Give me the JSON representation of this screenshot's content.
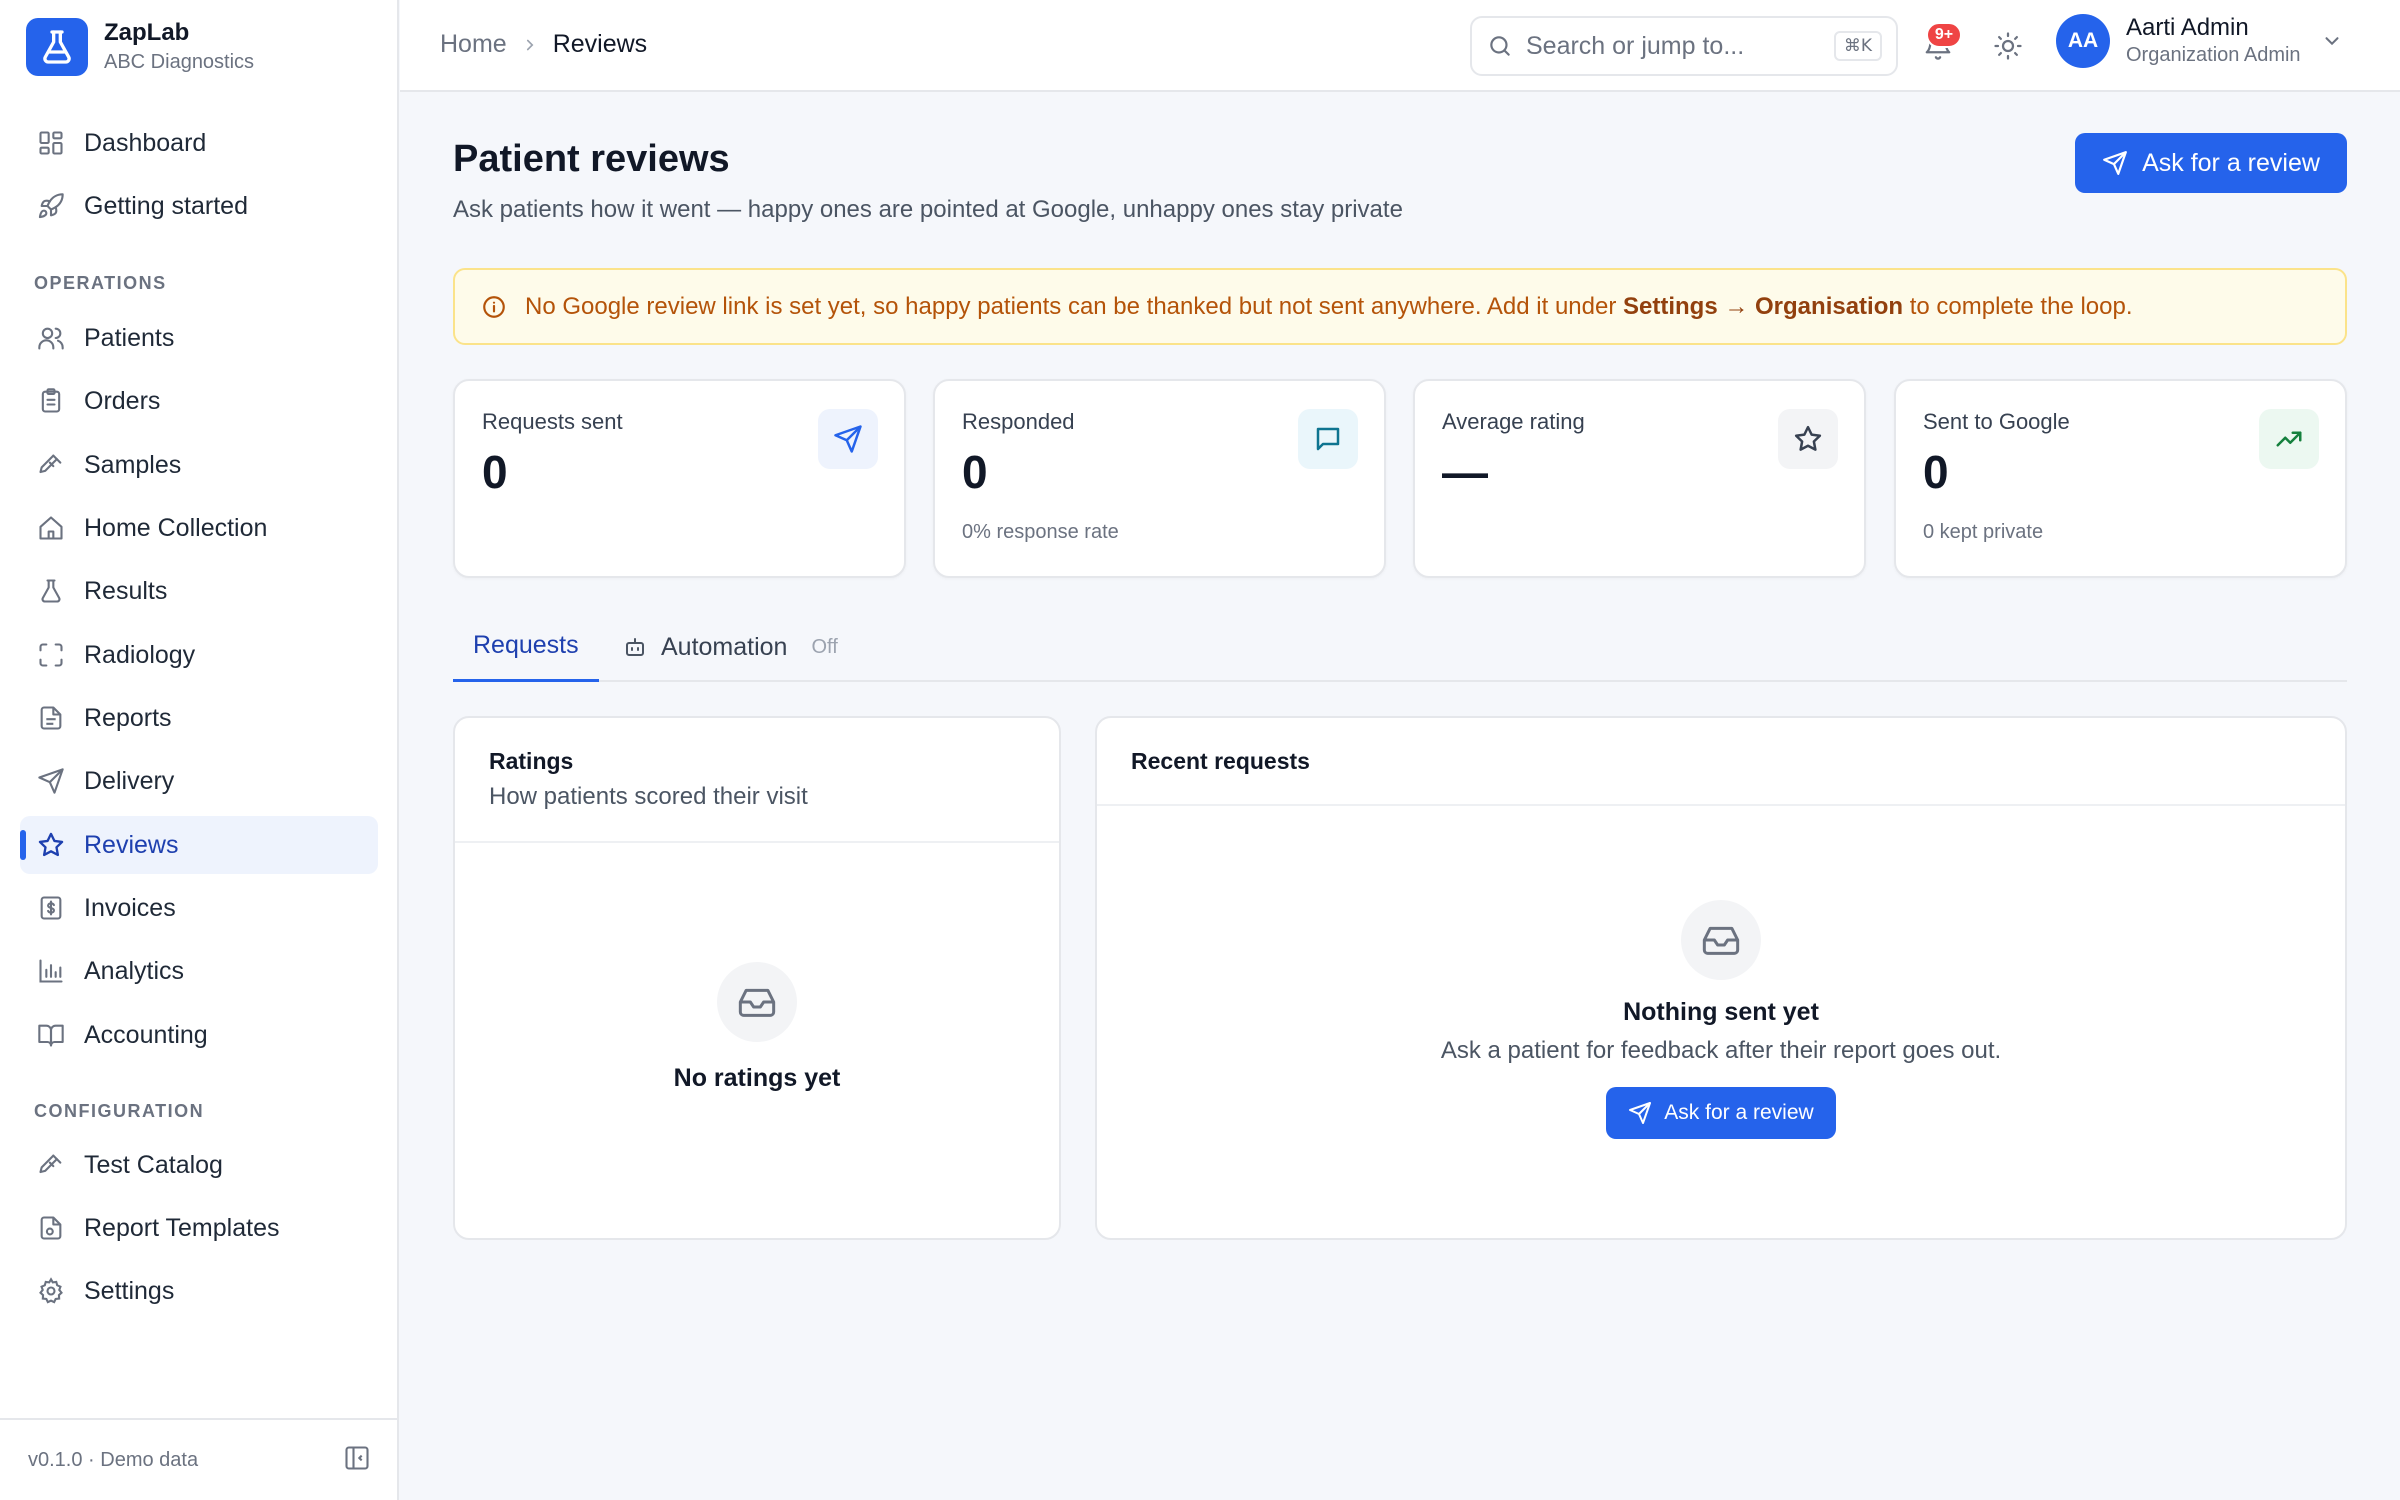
{
  "brand": {
    "name": "ZapLab",
    "org": "ABC Diagnostics",
    "logo_icon": "flask-icon"
  },
  "sidebar": {
    "items_top": [
      {
        "label": "Dashboard",
        "icon": "dashboard-icon"
      },
      {
        "label": "Getting started",
        "icon": "rocket-icon"
      }
    ],
    "sections": [
      {
        "label": "OPERATIONS"
      },
      {
        "label": "CONFIGURATION"
      }
    ],
    "operations": [
      {
        "label": "Patients"
      },
      {
        "label": "Orders"
      },
      {
        "label": "Samples"
      },
      {
        "label": "Home Collection"
      },
      {
        "label": "Results"
      },
      {
        "label": "Radiology"
      },
      {
        "label": "Reports"
      },
      {
        "label": "Delivery"
      },
      {
        "label": "Reviews"
      },
      {
        "label": "Invoices"
      },
      {
        "label": "Analytics"
      },
      {
        "label": "Accounting"
      }
    ],
    "configuration": [
      {
        "label": "Test Catalog"
      },
      {
        "label": "Report Templates"
      },
      {
        "label": "Settings"
      }
    ],
    "active": "Reviews",
    "footer": "v0.1.0 · Demo data"
  },
  "header": {
    "breadcrumb": {
      "home": "Home",
      "current": "Reviews"
    },
    "search": {
      "placeholder": "Search or jump to...",
      "shortcut": "⌘K"
    },
    "notifications_badge": "9+",
    "user": {
      "initials": "AA",
      "name": "Aarti Admin",
      "role": "Organization Admin"
    }
  },
  "page": {
    "title": "Patient reviews",
    "subtitle": "Ask patients how it went — happy ones are pointed at Google, unhappy ones stay private",
    "primary_button": "Ask for a review"
  },
  "alert": {
    "before": "No Google review link is set yet, so happy patients can be thanked but not sent anywhere. Add it under ",
    "link": "Settings → Organisation",
    "after": " to complete the loop."
  },
  "stats": [
    {
      "label": "Requests sent",
      "value": "0",
      "sub": "",
      "icon": "send-icon"
    },
    {
      "label": "Responded",
      "value": "0",
      "sub": "0% response rate",
      "icon": "message-icon"
    },
    {
      "label": "Average rating",
      "value": "—",
      "sub": "",
      "icon": "star-icon"
    },
    {
      "label": "Sent to Google",
      "value": "0",
      "sub": "0 kept private",
      "icon": "trending-up-icon"
    }
  ],
  "tabs": {
    "requests": "Requests",
    "automation": "Automation",
    "automation_status": "Off"
  },
  "ratings_card": {
    "title": "Ratings",
    "subtitle": "How patients scored their visit",
    "empty": "No ratings yet"
  },
  "requests_card": {
    "title": "Recent requests",
    "empty_title": "Nothing sent yet",
    "empty_sub": "Ask a patient for feedback after their report goes out.",
    "button": "Ask for a review"
  },
  "colors": {
    "accent": "#2563eb",
    "warning_bg": "#fefbea",
    "warning_text": "#b45309"
  }
}
